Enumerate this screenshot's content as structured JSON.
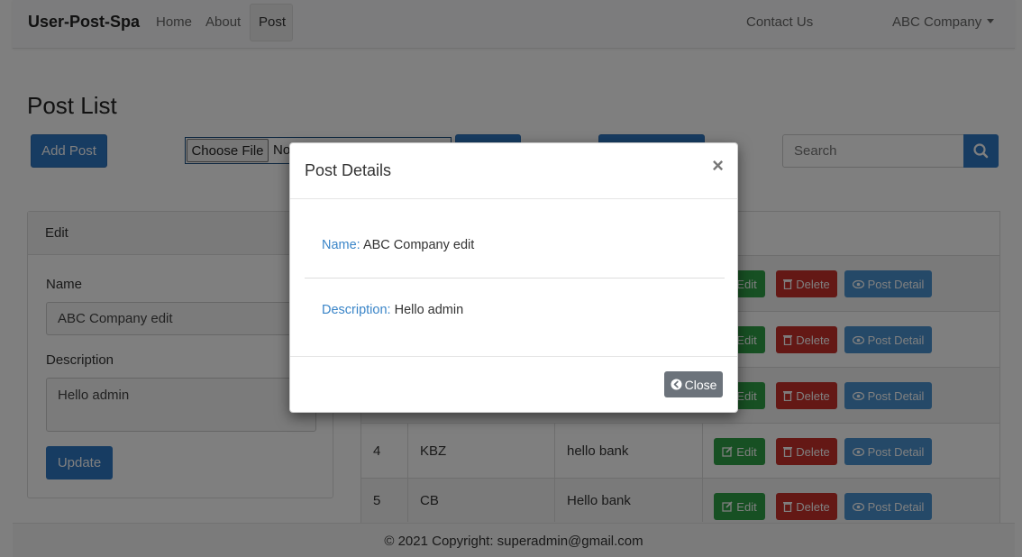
{
  "navbar": {
    "brand": "User-Post-Spa",
    "links": [
      "Home",
      "About",
      "Post"
    ],
    "contact": "Contact Us",
    "company": "ABC Company"
  },
  "page": {
    "title": "Post List",
    "add_post": "Add Post",
    "choose_file": "Choose File",
    "file_status": "No",
    "search_placeholder": "Search"
  },
  "edit_panel": {
    "heading": "Edit",
    "name_label": "Name",
    "name_value": "ABC Company edit",
    "description_label": "Description",
    "description_value": "Hello admin",
    "update": "Update"
  },
  "table": {
    "rows": [
      {
        "id": "4",
        "name": "KBZ",
        "description": "hello bank"
      },
      {
        "id": "5",
        "name": "CB",
        "description": "Hello bank"
      }
    ],
    "actions": {
      "edit": "Edit",
      "delete": "Delete",
      "detail": "Post Detail"
    }
  },
  "footer": {
    "text": "© 2021 Copyright: superadmin@gmail.com"
  },
  "modal": {
    "title": "Post Details",
    "close_symbol": "×",
    "name_key": "Name:",
    "name_value": "ABC Company edit",
    "description_key": "Description:",
    "description_value": "Hello admin",
    "close": "Close"
  },
  "colors": {
    "primary": "#2f78c4",
    "success": "#2fa046",
    "danger": "#c8302b",
    "info": "#4a93d0",
    "secondary": "#6c737b"
  }
}
